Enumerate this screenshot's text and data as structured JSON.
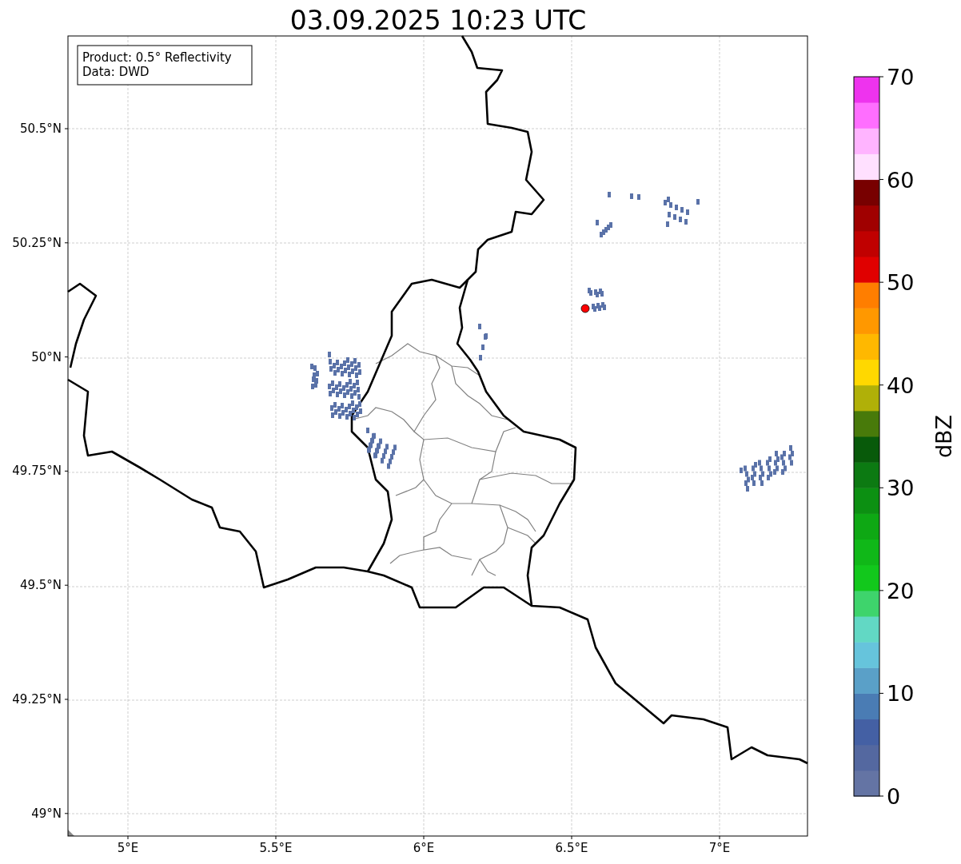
{
  "title": "03.09.2025 10:23 UTC",
  "info_box": [
    "Product: 0.5° Reflectivity",
    "Data: DWD"
  ],
  "map": {
    "xticks": [
      "5°E",
      "5.5°E",
      "6°E",
      "6.5°E",
      "7°E"
    ],
    "yticks": [
      "50.5°N",
      "50.25°N",
      "50°N",
      "49.75°N",
      "49.5°N",
      "49.25°N",
      "49°N"
    ]
  },
  "colorbar": {
    "label": "dBZ",
    "ticks": [
      "70",
      "60",
      "50",
      "40",
      "30",
      "20",
      "10",
      "0"
    ],
    "bands": [
      {
        "color": "#6474a4"
      },
      {
        "color": "#5468a0"
      },
      {
        "color": "#4460a4"
      },
      {
        "color": "#4a7cb4"
      },
      {
        "color": "#5aa0c8"
      },
      {
        "color": "#66c4dc"
      },
      {
        "color": "#62d8c4"
      },
      {
        "color": "#3ed46c"
      },
      {
        "color": "#12c81c"
      },
      {
        "color": "#10b818"
      },
      {
        "color": "#0ea814"
      },
      {
        "color": "#0c9012"
      },
      {
        "color": "#0c7a12"
      },
      {
        "color": "#085a0a"
      },
      {
        "color": "#487a0a"
      },
      {
        "color": "#b0b008"
      },
      {
        "color": "#ffd800"
      },
      {
        "color": "#ffb800"
      },
      {
        "color": "#ff9800"
      },
      {
        "color": "#ff7e00"
      },
      {
        "color": "#e00000"
      },
      {
        "color": "#c00000"
      },
      {
        "color": "#a00000"
      },
      {
        "color": "#780000"
      },
      {
        "color": "#ffe0ff"
      },
      {
        "color": "#ffb4ff"
      },
      {
        "color": "#ff6eff"
      },
      {
        "color": "#ee33ee"
      }
    ]
  }
}
